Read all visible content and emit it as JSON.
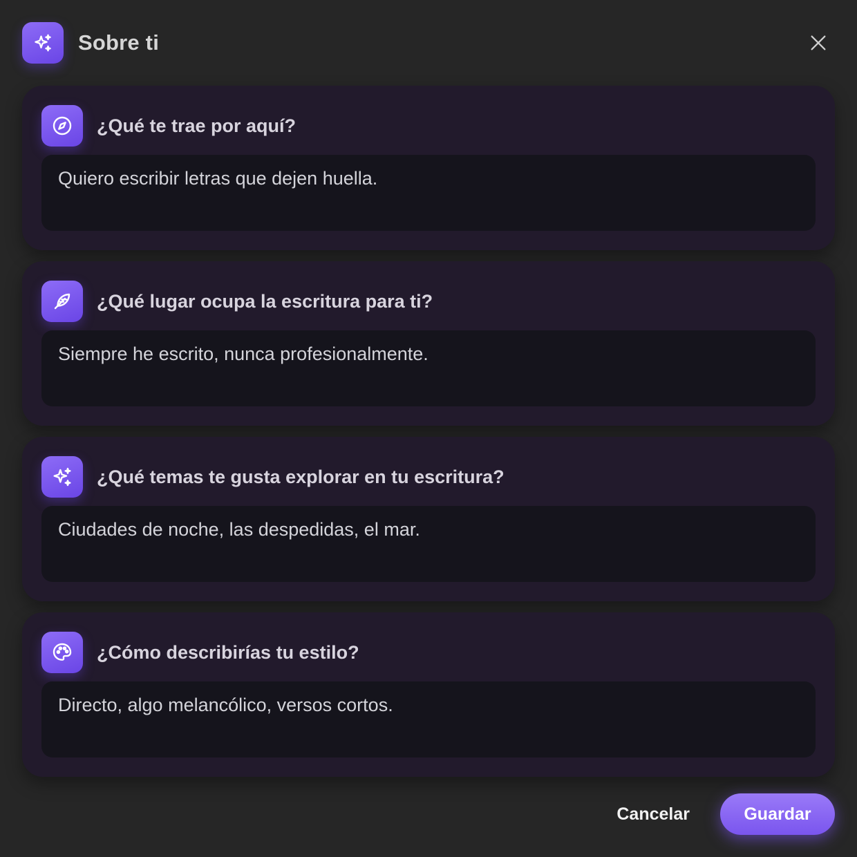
{
  "dialog": {
    "title": "Sobre ti",
    "title_icon": "sparkles-icon",
    "close_icon": "close-icon"
  },
  "questions": [
    {
      "icon": "compass-icon",
      "label": "¿Qué te trae por aquí?",
      "answer": "Quiero escribir letras que dejen huella."
    },
    {
      "icon": "feather-icon",
      "label": "¿Qué lugar ocupa la escritura para ti?",
      "answer": "Siempre he escrito, nunca profesionalmente."
    },
    {
      "icon": "sparkles-icon",
      "label": "¿Qué temas te gusta explorar en tu escritura?",
      "answer": "Ciudades de noche, las despedidas, el mar."
    },
    {
      "icon": "palette-icon",
      "label": "¿Cómo describirías tu estilo?",
      "answer": "Directo, algo melancólico, versos cortos."
    }
  ],
  "footer": {
    "cancel_label": "Cancelar",
    "save_label": "Guardar"
  },
  "colors": {
    "accent": "#7c5cf2",
    "background": "#262626",
    "card": "#221a2c",
    "input": "#15141c"
  }
}
